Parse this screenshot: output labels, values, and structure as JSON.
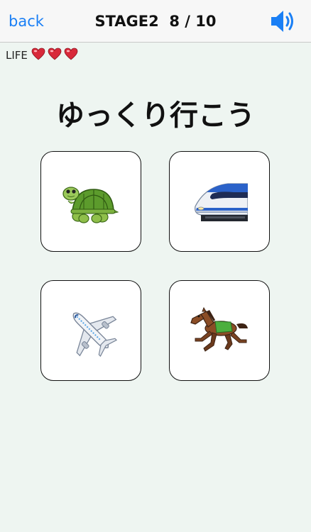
{
  "nav": {
    "back_label": "back",
    "stage_label": "STAGE2",
    "progress": "8 / 10",
    "sound_icon": "speaker-icon",
    "accent_color": "#1a7ff5"
  },
  "life": {
    "label": "LIFE",
    "hearts": 3,
    "heart_icon": "heart-icon",
    "heart_color": "#d8293a"
  },
  "question": {
    "phrase": "ゆっくり行こう"
  },
  "choices": [
    {
      "icon": "turtle-icon"
    },
    {
      "icon": "bullet-train-icon"
    },
    {
      "icon": "airplane-icon"
    },
    {
      "icon": "racehorse-icon"
    }
  ]
}
